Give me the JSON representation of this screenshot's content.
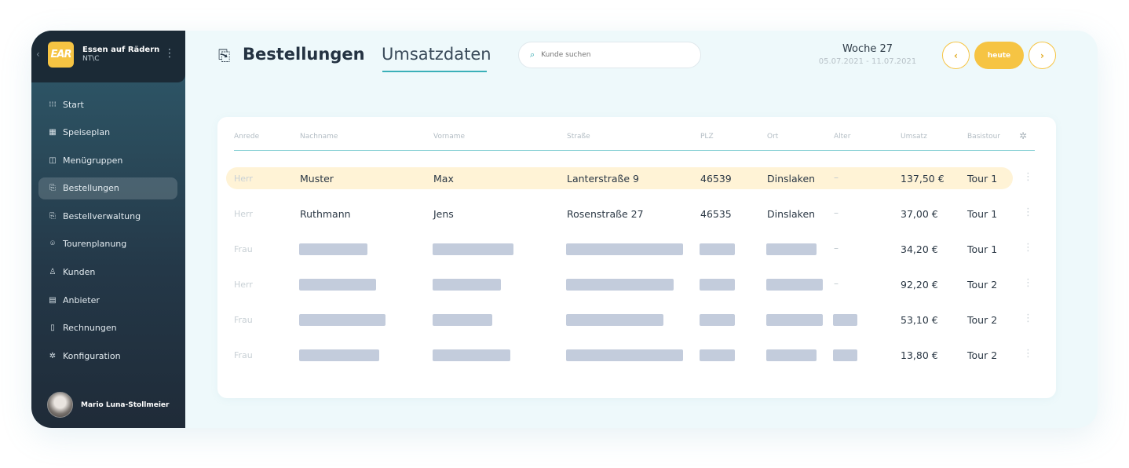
{
  "sidebar": {
    "brand_name": "Essen auf Rädern",
    "brand_sub": "NT\\C",
    "logo_text": "EAR",
    "items": [
      {
        "label": "Start",
        "icon": "grid-dots-icon",
        "glyph": "⁝⁝⁝"
      },
      {
        "label": "Speiseplan",
        "icon": "menu-plan-icon",
        "glyph": "▦"
      },
      {
        "label": "Menügruppen",
        "icon": "layout-icon",
        "glyph": "◫"
      },
      {
        "label": "Bestellungen",
        "icon": "order-doc-icon",
        "glyph": "⎘",
        "active": true
      },
      {
        "label": "Bestellverwaltung",
        "icon": "order-manage-icon",
        "glyph": "⎘"
      },
      {
        "label": "Tourenplanung",
        "icon": "map-pin-icon",
        "glyph": "⌾"
      },
      {
        "label": "Kunden",
        "icon": "user-icon",
        "glyph": "♙"
      },
      {
        "label": "Anbieter",
        "icon": "card-icon",
        "glyph": "▤"
      },
      {
        "label": "Rechnungen",
        "icon": "invoice-icon",
        "glyph": "▯"
      },
      {
        "label": "Konfiguration",
        "icon": "gear-icon",
        "glyph": "✲"
      }
    ],
    "user_name": "Mario Luna-Stollmeier"
  },
  "header": {
    "title": "Bestellungen",
    "tab": "Umsatzdaten",
    "search_placeholder": "Kunde suchen",
    "week_label": "Woche 27",
    "week_range": "05.07.2021 - 11.07.2021",
    "prev": "‹",
    "next": "›",
    "today": "heute"
  },
  "table": {
    "columns": [
      "Anrede",
      "Nachname",
      "Vorname",
      "Straße",
      "PLZ",
      "Ort",
      "Alter",
      "Umsatz",
      "Basistour"
    ],
    "rows": [
      {
        "anrede": "Herr",
        "nachname": "Muster",
        "vorname": "Max",
        "strasse": "Lanterstraße 9",
        "plz": "46539",
        "ort": "Dinslaken",
        "alter": "–",
        "umsatz": "137,50 €",
        "tour": "Tour 1",
        "highlight": true
      },
      {
        "anrede": "Herr",
        "nachname": "Ruthmann",
        "vorname": "Jens",
        "strasse": "Rosenstraße 27",
        "plz": "46535",
        "ort": "Dinslaken",
        "alter": "–",
        "umsatz": "37,00 €",
        "tour": "Tour 1"
      },
      {
        "anrede": "Frau",
        "alter": "–",
        "umsatz": "34,20 €",
        "tour": "Tour 1"
      },
      {
        "anrede": "Herr",
        "alter": "–",
        "umsatz": "92,20 €",
        "tour": "Tour 2"
      },
      {
        "anrede": "Frau",
        "umsatz": "53,10 €",
        "tour": "Tour 2"
      },
      {
        "anrede": "Frau",
        "umsatz": "13,80 €",
        "tour": "Tour 2"
      }
    ]
  },
  "colors": {
    "accent": "#f6c443",
    "teal": "#3ab0b8",
    "highlight_row": "#fff3d6"
  }
}
